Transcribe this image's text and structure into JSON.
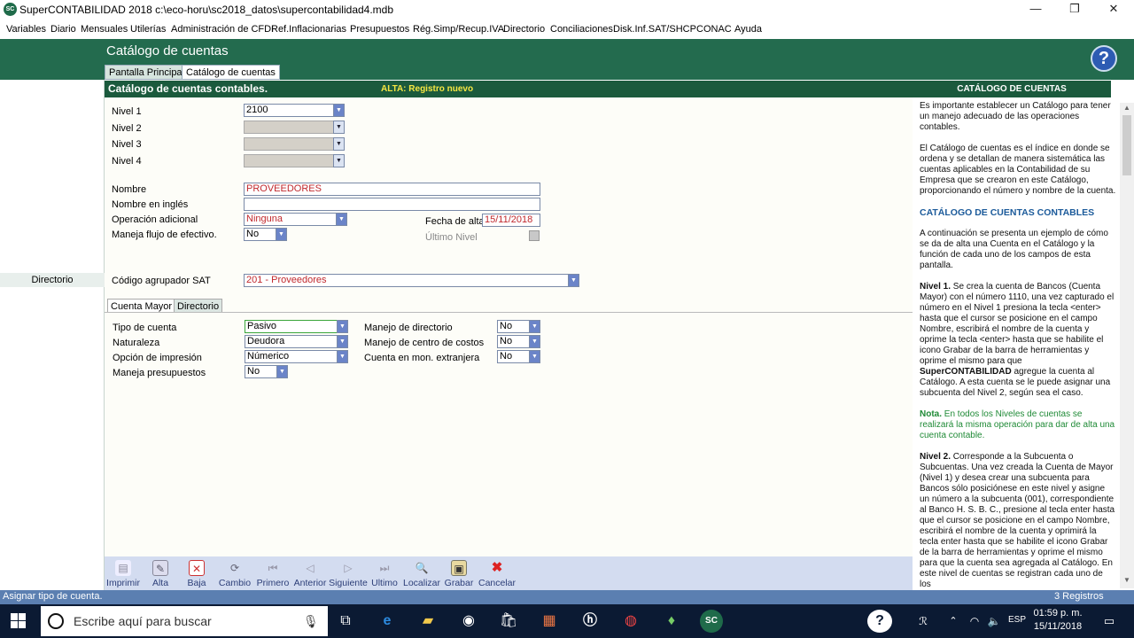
{
  "window": {
    "title": "SuperCONTABILIDAD 2018 c:\\eco-horu\\sc2018_datos\\supercontabilidad4.mdb",
    "app_icon": "SC",
    "minimize": "—",
    "restore": "❐",
    "close": "✕"
  },
  "menu": [
    "Variables",
    "Diario",
    "Mensuales",
    "Utilerías",
    "Administración de CFDI",
    "Ref.Inflacionarias",
    "Presupuestos",
    "Rég.Simp/Recup.IVA",
    "Directorio",
    "Conciliaciones",
    "Disk.Inf.SAT/SHCP",
    "CONAC",
    "Ayuda"
  ],
  "header": {
    "title": "Catálogo de cuentas",
    "tabs": [
      "Pantalla Principal",
      "Catálogo de cuentas"
    ],
    "help": "?"
  },
  "left": {
    "directorio": "Directorio"
  },
  "form": {
    "title": "Catálogo de cuentas contables.",
    "mode": "ALTA: Registro nuevo",
    "nivel1_label": "Nivel 1",
    "nivel1_value": "2100",
    "nivel2_label": "Nivel 2",
    "nivel3_label": "Nivel 3",
    "nivel4_label": "Nivel 4",
    "nombre_label": "Nombre",
    "nombre_value": "PROVEEDORES",
    "nombre_ingles_label": "Nombre en inglés",
    "nombre_ingles_value": "",
    "operacion_label": "Operación adicional",
    "operacion_value": "Ninguna",
    "fecha_label": "Fecha de alta",
    "fecha_value": "15/11/2018",
    "flujo_label": "Maneja flujo de efectivo.",
    "flujo_value": "No",
    "ultimo_label": "Último Nivel",
    "sat_label": "Código agrupador SAT",
    "sat_value": "201 - Proveedores",
    "subtabs": [
      "Cuenta Mayor",
      "Directorio"
    ],
    "tipo_label": "Tipo de cuenta",
    "tipo_value": "Pasivo",
    "naturaleza_label": "Naturaleza",
    "naturaleza_value": "Deudora",
    "impresion_label": "Opción de impresión",
    "impresion_value": "Númerico",
    "presupuestos_label": "Maneja presupuestos",
    "presupuestos_value": "No",
    "directorio_label": "Manejo de directorio",
    "directorio_value": "No",
    "costos_label": "Manejo de centro de costos",
    "costos_value": "No",
    "extranjera_label": "Cuenta en mon. extranjera",
    "extranjera_value": "No"
  },
  "toolbar": [
    "Imprimir",
    "Alta",
    "Baja",
    "Cambio",
    "Primero",
    "Anterior",
    "Siguiente",
    "Ultimo",
    "Localizar",
    "Grabar",
    "Cancelar"
  ],
  "help_panel": {
    "title": "CATÁLOGO DE CUENTAS",
    "p1": "Es importante establecer un Catálogo para tener un manejo adecuado de las operaciones contables.",
    "p2": "El Catálogo de cuentas es el índice en donde se ordena y se detallan de manera sistemática las cuentas aplicables en la Contabilidad de su Empresa que se crearon en este Catálogo, proporcionando el número y nombre de la cuenta.",
    "sub": "CATÁLOGO DE CUENTAS CONTABLES",
    "p3": "A continuación se presenta un ejemplo de cómo se da de alta una Cuenta en el Catálogo y la función de cada uno de los campos de esta pantalla.",
    "p4_bold": "Nivel 1.",
    "p4": " Se crea la cuenta de Bancos (Cuenta Mayor) con el número 1110, una vez capturado el número en el Nivel 1 presiona la tecla <enter> hasta que el cursor se posicione en el campo Nombre, escribirá el nombre de la cuenta y oprime la tecla <enter> hasta que se habilite el icono Grabar de la barra de herramientas y oprime el mismo para que ",
    "p4_bold2": "SuperCONTABILIDAD",
    "p4_end": " agregue la cuenta al Catálogo. A esta cuenta se le puede asignar una subcuenta del  Nivel 2, según sea el caso.",
    "note_bold": "Nota.",
    "note": " En todos los Niveles de cuentas se realizará la misma operación para dar de alta una cuenta contable.",
    "p5_bold": "Nivel 2.",
    "p5": " Corresponde a la Subcuenta o Subcuentas. Una vez creada la Cuenta de Mayor (Nivel 1) y desea crear una subcuenta para Bancos sólo posiciónese en este nivel y asigne un número a la subcuenta (001), correspondiente al Banco H. S. B. C.,  presione al tecla enter hasta que el cursor se posicione en el campo Nombre, escribirá el nombre de la cuenta y oprimirá la tecla enter hasta que se habilite el icono Grabar de la barra de herramientas y oprime el mismo para que la cuenta sea agregada al Catálogo. En este nivel de cuentas se registran cada uno de los"
  },
  "status": {
    "text": "Asignar tipo de cuenta.",
    "records": "3 Registros"
  },
  "taskbar": {
    "search_placeholder": "Escribe aquí para buscar",
    "lang": "ESP",
    "time": "01:59 p. m.",
    "date": "15/11/2018"
  }
}
